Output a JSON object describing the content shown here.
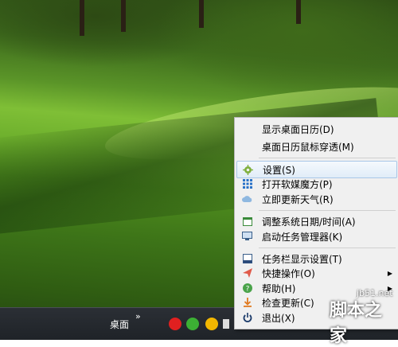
{
  "taskbar": {
    "desktop_label": "桌面",
    "overflow_chevron": "»"
  },
  "context_menu": {
    "items": [
      {
        "label": "显示桌面日历(D)",
        "icon": "none"
      },
      {
        "label": "桌面日历鼠标穿透(M)",
        "icon": "none"
      },
      {
        "label": "设置(S)",
        "icon": "gear-icon",
        "highlighted": true
      },
      {
        "label": "打开软媒魔方(P)",
        "icon": "grid-icon"
      },
      {
        "label": "立即更新天气(R)",
        "icon": "cloud-icon"
      },
      {
        "label": "调整系统日期/时间(A)",
        "icon": "calendar-icon"
      },
      {
        "label": "启动任务管理器(K)",
        "icon": "monitor-icon"
      },
      {
        "label": "任务栏显示设置(T)",
        "icon": "taskbar-icon"
      },
      {
        "label": "快捷操作(O)",
        "icon": "paper-plane-icon",
        "submenu": true
      },
      {
        "label": "帮助(H)",
        "icon": "help-icon",
        "submenu": true
      },
      {
        "label": "检查更新(C)",
        "icon": "download-icon"
      },
      {
        "label": "退出(X)",
        "icon": "power-icon"
      }
    ]
  },
  "watermark": {
    "site": "jb51.net",
    "name": "脚本之家"
  },
  "colors": {
    "menu_background": "#f0f0f0",
    "menu_highlight": "#e1ecf8",
    "taskbar": "#1f2328"
  }
}
